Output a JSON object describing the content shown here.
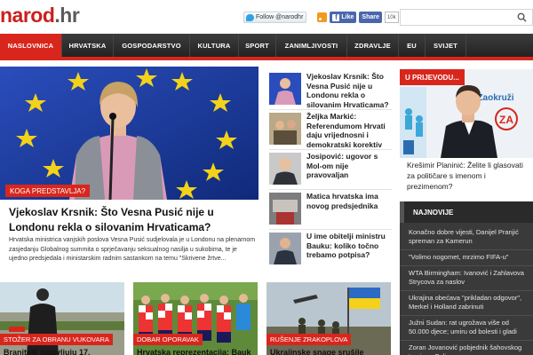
{
  "header": {
    "logo_main": "narod",
    "logo_tld": ".hr",
    "twitter_label": "Follow @narodhr",
    "fb_like_label": "Like",
    "fb_share_label": "Share",
    "fb_count": "10k",
    "search_placeholder": ""
  },
  "nav": {
    "items": [
      {
        "label": "NASLOVNICA",
        "active": true
      },
      {
        "label": "HRVATSKA"
      },
      {
        "label": "GOSPODARSTVO"
      },
      {
        "label": "KULTURA"
      },
      {
        "label": "SPORT"
      },
      {
        "label": "ZANIMLJIVOSTI"
      },
      {
        "label": "ZDRAVLJE"
      },
      {
        "label": "EU"
      },
      {
        "label": "SVIJET"
      }
    ]
  },
  "hero": {
    "tag": "KOGA PREDSTAVLJA?",
    "title": "Vjekoslav Krsnik: Što Vesna Pusić nije u Londonu rekla o silovanim Hrvaticama?",
    "text": "Hrvatska ministrica vanjskih poslova Vesna Pusić sudjelovala je u Londonu na plenarnom zasjedanju Globalnog summita o sprječavanju seksualnog nasilja u sukobima, te je ujedno predsjedala i ministarskim radnim sastankom na temu \"Skrivene žrtve..."
  },
  "middle": {
    "items": [
      {
        "title": "Vjekoslav Krsnik: Što Vesna Pusić nije u Londonu rekla o silovanim Hrvaticama?"
      },
      {
        "title": "Željka Markić: Referendumom Hrvati daju vrijednosni i demokratski korektiv"
      },
      {
        "title": "Josipović: ugovor s Mol-om nije pravovaljan"
      },
      {
        "title": "Matica hrvatska ima novog predsjednika"
      },
      {
        "title": "U ime obitelji ministru Bauku: koliko točno trebamo potpisa?"
      }
    ]
  },
  "promo": {
    "tag": "U PRIJEVODU...",
    "banner_word": "Zaokruži",
    "banner_za": "ZA",
    "text": "Krešimir Planinić: Želite li glasovati za političare s imenom i prezimenom?"
  },
  "najnovije": {
    "heading": "NAJNOVIJE",
    "items": [
      "Konačno dobre vijesti, Danijel Pranjić spreman za Kamerun",
      "\"Volimo nogomet, mrzimo FIFA-u\"",
      "WTA Birmingham: Ivanović i Zahlavova Strycova za naslov",
      "Ukrajina obećava \"prikladan odgovor\", Merkel i Holland zabrinuti",
      "Južni Sudan: rat ugrožava više od 50.000 djece; umiru od bolesti i gladi",
      "Zoran Jovanović pobjednik šahovskog turnira u Puli"
    ]
  },
  "bottom": [
    {
      "tag": "STOŽER ZA OBRANU VUKOVARA",
      "title": "Branitelji najavljuju 17."
    },
    {
      "tag": "DOBAR OPORAVAK",
      "title": "Hrvatska reprezentacija: Bauk"
    },
    {
      "tag": "RUŠENJE ZRAKOPLOVA",
      "title": "Ukrajinske snage srušile"
    }
  ],
  "colors": {
    "brand_red": "#d9261c",
    "nav_dark": "#2b2b2b",
    "sidebar_dark": "#3a3a3a"
  }
}
